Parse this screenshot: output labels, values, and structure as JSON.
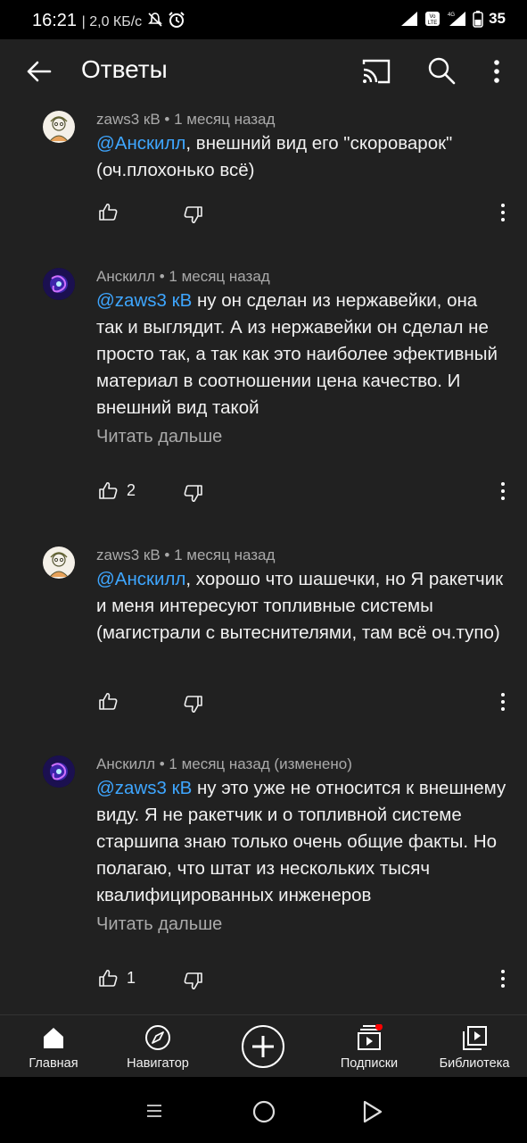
{
  "status": {
    "time": "16:21",
    "network_speed": "| 2,0 КБ/с",
    "battery": "35"
  },
  "appbar": {
    "title": "Ответы",
    "icons": [
      "back-arrow-icon",
      "cast-icon",
      "search-icon",
      "more-vert-icon"
    ]
  },
  "comments": [
    {
      "author": "zaws3 кВ",
      "time": "1 месяц назад",
      "mention": "@Анскилл",
      "text": ", внешний вид его \"скороварок\" (оч.плохонько всё)",
      "likes": ""
    },
    {
      "author": "Анскилл",
      "time": "1 месяц назад",
      "mention": "@zaws3 кВ",
      "text": " ну он сделан из нержавейки, она так и выглядит. А из нержавейки он сделал не просто так, а так как это наиболее эфективный материал в соотношении цена качество. И внешний вид такой",
      "read_more": "Читать дальше",
      "likes": "2"
    },
    {
      "author": "zaws3 кВ",
      "time": "1 месяц назад",
      "mention": "@Анскилл",
      "text": ", хорошо что шашечки, но Я ракетчик и меня интересуют топливные системы (магистрали с вытеснителями, там всё оч.тупо)",
      "likes": ""
    },
    {
      "author": "Анскилл",
      "time": "1 месяц назад (изменено)",
      "mention": "@zaws3 кВ",
      "text": " ну это уже не относится к внешнему виду. Я не ракетчик и о топливной системе старшипа знаю только очень общие факты. Но полагаю, что штат из нескольких тысяч квалифицированных инженеров",
      "read_more": "Читать дальше",
      "likes": "1"
    }
  ],
  "bottom_nav": {
    "home": "Главная",
    "explore": "Навигатор",
    "subscriptions": "Подписки",
    "library": "Библиотека"
  },
  "colors": {
    "background": "#212121",
    "mention": "#3ea6ff",
    "secondary_text": "#aaaaaa",
    "notification_dot": "#ff0000"
  }
}
